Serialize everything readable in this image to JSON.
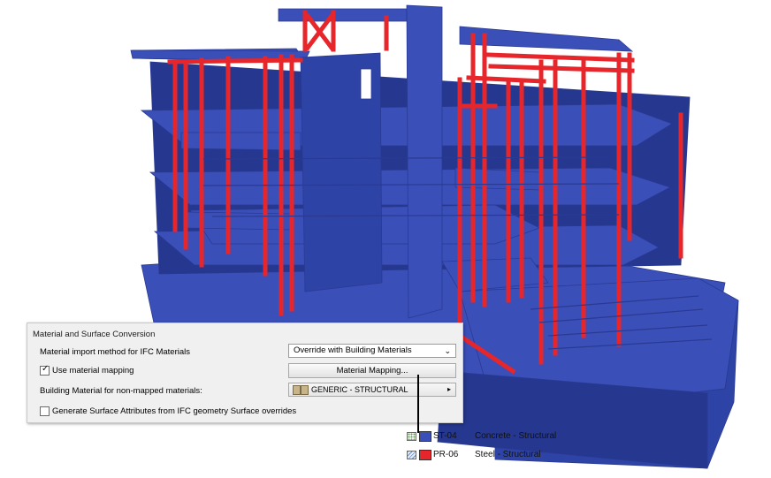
{
  "colors": {
    "concrete": "#3a4fb8",
    "concrete_dark": "#25378f",
    "concrete_side": "#2e43a6",
    "steel": "#e6262a",
    "steel_light": "#ff5a5a"
  },
  "panel": {
    "title": "Material and Surface Conversion",
    "import_method_label": "Material import method for IFC Materials",
    "import_method_value": "Override with Building Materials",
    "use_mapping_label": "Use material mapping",
    "use_mapping_checked": true,
    "mapping_button": "Material Mapping...",
    "non_mapped_label": "Building Material for non-mapped materials:",
    "non_mapped_value": "GENERIC - STRUCTURAL",
    "surface_attr_label": "Generate Surface Attributes from IFC geometry Surface overrides",
    "surface_attr_checked": false
  },
  "legend": [
    {
      "code": "ST-04",
      "name": "Concrete - Structural",
      "color": "#3a4fb8",
      "icon": "concrete-hatch-icon"
    },
    {
      "code": "PR-06",
      "name": "Steel - Structural",
      "color": "#e6262a",
      "icon": "steel-hatch-icon"
    }
  ]
}
